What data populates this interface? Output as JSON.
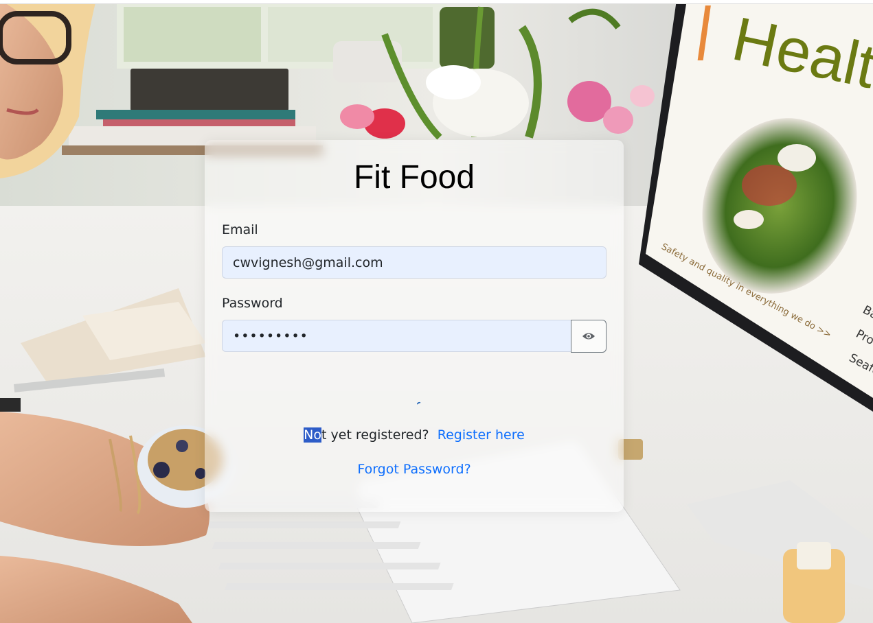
{
  "app": {
    "title": "Fit Food"
  },
  "background": {
    "monitor_heading": "Health",
    "monitor_tagline": "Safety and quality in everything we do >>",
    "monitor_list": [
      "Bas",
      "Prote",
      "Seafo"
    ]
  },
  "form": {
    "email_label": "Email",
    "email_value": "cwvignesh@gmail.com",
    "password_label": "Password",
    "password_value": "•••••••••",
    "show_password_icon": "eye-icon"
  },
  "footer": {
    "register_prompt_selected": "No",
    "register_prompt_rest": "t yet registered?",
    "register_link": "Register here",
    "forgot_link": "Forgot Password?"
  },
  "colors": {
    "link": "#0d6efd",
    "input_bg": "#e8f0fe",
    "selection": "#2d5cc8",
    "heading_green": "#6b7a12"
  }
}
